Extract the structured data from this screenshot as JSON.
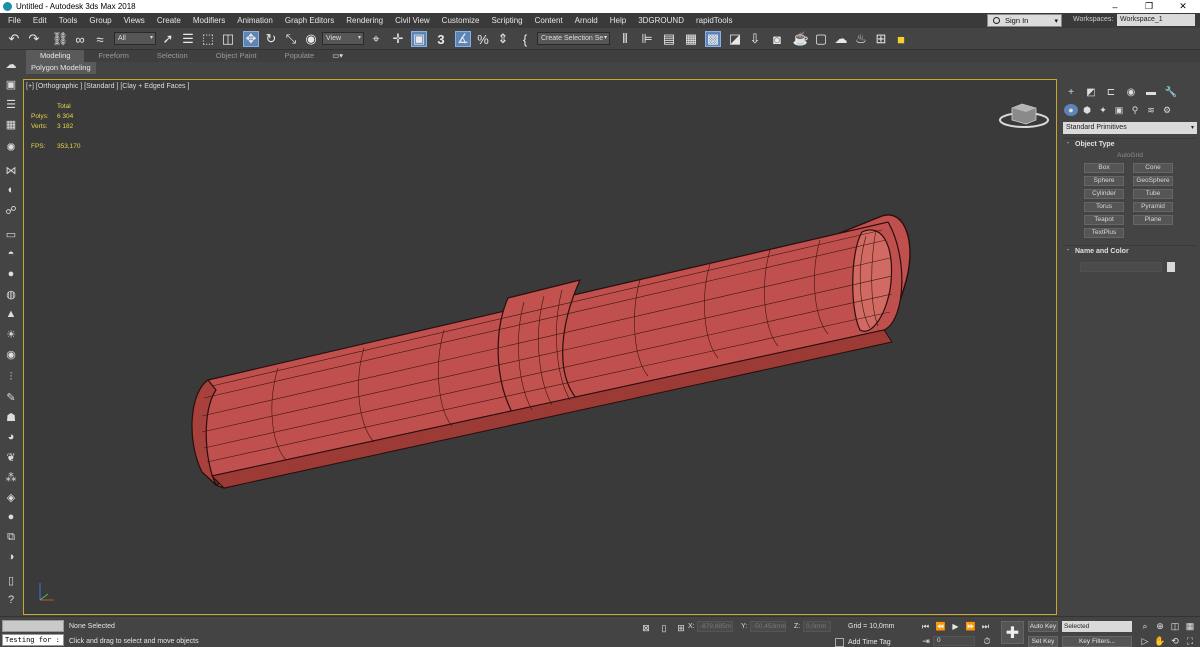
{
  "window": {
    "title": "Untitled - Autodesk 3ds Max 2018",
    "controls": [
      "–",
      "❐",
      "✕"
    ]
  },
  "menu": [
    "File",
    "Edit",
    "Tools",
    "Group",
    "Views",
    "Create",
    "Modifiers",
    "Animation",
    "Graph Editors",
    "Rendering",
    "Civil View",
    "Customize",
    "Scripting",
    "Content",
    "Arnold",
    "Help",
    "3DGROUND",
    "rapidTools"
  ],
  "account": {
    "sign_in": "Sign In",
    "workspaces_label": "Workspaces:",
    "workspace": "Workspace_1"
  },
  "toolbar": {
    "filter": "All",
    "ref_coord": "View",
    "selection_set": "Create Selection Se",
    "snap_value": "3"
  },
  "ribbon": {
    "tabs": [
      {
        "label": "Modeling",
        "active": true
      },
      {
        "label": "Freeform",
        "active": false
      },
      {
        "label": "Selection",
        "active": false
      },
      {
        "label": "Object Paint",
        "active": false
      },
      {
        "label": "Populate",
        "active": false
      }
    ],
    "sub": "Polygon Modeling"
  },
  "viewport": {
    "label": "[+] [Orthographic ] [Standard ] [Clay + Edged Faces ]",
    "stats": {
      "header": "Total",
      "polys_label": "Polys:",
      "polys": "6 304",
      "verts_label": "Verts:",
      "verts": "3 182",
      "fps_label": "FPS:",
      "fps": "353,170"
    },
    "model_color": "#c0504d",
    "frame_color": "#c7a82b"
  },
  "command_panel": {
    "category": "Standard Primitives",
    "object_type_title": "Object Type",
    "autogrid": "AutoGrid",
    "buttons": [
      "Box",
      "Cone",
      "Sphere",
      "GeoSphere",
      "Cylinder",
      "Tube",
      "Torus",
      "Pyramid",
      "Teapot",
      "Plane",
      "TextPlus"
    ],
    "name_color_title": "Name and Color"
  },
  "status": {
    "maxscript_input": "Testing for :",
    "selection": "None Selected",
    "prompt": "Click and drag to select and move objects",
    "x_label": "X:",
    "x_value": "-879,885m",
    "y_label": "Y:",
    "y_value": "-50,453mm",
    "z_label": "Z:",
    "z_value": "0,0mm",
    "grid": "Grid = 10,0mm",
    "add_time_tag": "Add Time Tag",
    "frame": "0",
    "auto_key": "Auto Key",
    "set_key": "Set Key",
    "key_mode": "Selected",
    "key_filters": "Key Filters..."
  }
}
